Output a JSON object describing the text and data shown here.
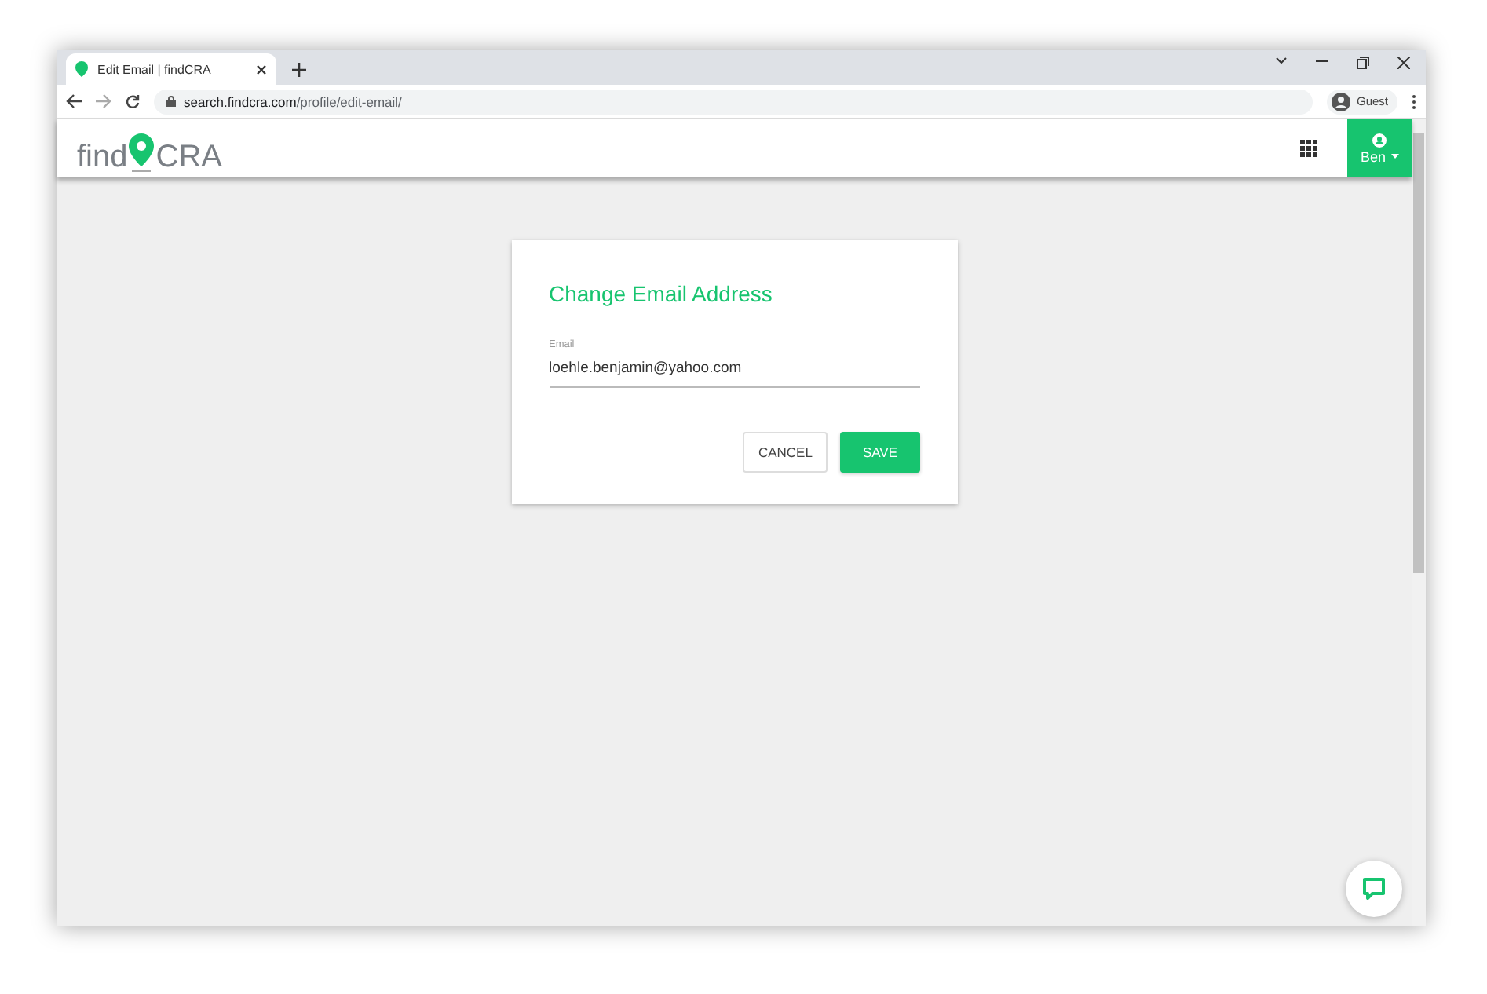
{
  "browser": {
    "tab_title": "Edit Email | findCRA",
    "url_host": "search.findcra.com",
    "url_path": "/profile/edit-email/",
    "profile": "Guest"
  },
  "header": {
    "logo_left": "find",
    "logo_right": "CRA",
    "user": "Ben"
  },
  "dialog": {
    "title": "Change Email Address",
    "field_label": "Email",
    "field_value": "loehle.benjamin@yahoo.com",
    "buttons": [
      {
        "label": "CANCEL",
        "kind": "outline"
      },
      {
        "label": "SAVE",
        "kind": "primary"
      }
    ]
  }
}
